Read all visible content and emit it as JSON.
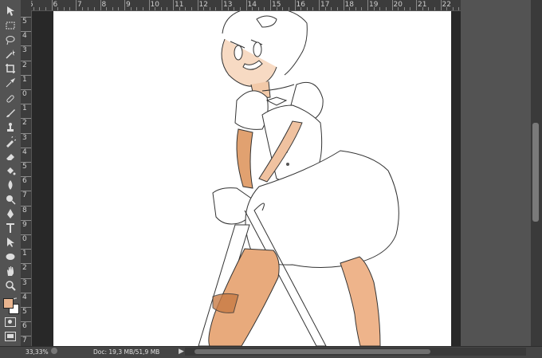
{
  "ruler": {
    "top_ticks": [
      "5",
      "6",
      "7",
      "8",
      "9",
      "10",
      "11",
      "12",
      "13",
      "14",
      "15",
      "16",
      "17",
      "18",
      "19",
      "20",
      "21",
      "22"
    ],
    "left_ticks": [
      "5",
      "4",
      "3",
      "2",
      "1",
      "0",
      "1",
      "2",
      "3",
      "4",
      "5",
      "6",
      "7",
      "8",
      "9",
      "0",
      "1",
      "2",
      "3",
      "4",
      "5",
      "6",
      "7"
    ]
  },
  "tools": [
    {
      "name": "move-tool-icon"
    },
    {
      "name": "marquee-tool-icon"
    },
    {
      "name": "lasso-tool-icon"
    },
    {
      "name": "magic-wand-tool-icon"
    },
    {
      "name": "crop-tool-icon"
    },
    {
      "name": "eyedropper-tool-icon"
    },
    {
      "name": "healing-brush-tool-icon"
    },
    {
      "name": "brush-tool-icon"
    },
    {
      "name": "clone-stamp-tool-icon"
    },
    {
      "name": "history-brush-tool-icon"
    },
    {
      "name": "eraser-tool-icon"
    },
    {
      "name": "paint-bucket-tool-icon"
    },
    {
      "name": "blur-tool-icon"
    },
    {
      "name": "dodge-tool-icon"
    },
    {
      "name": "pen-tool-icon"
    },
    {
      "name": "type-tool-icon"
    },
    {
      "name": "path-selection-tool-icon"
    },
    {
      "name": "ellipse-tool-icon"
    },
    {
      "name": "hand-tool-icon"
    },
    {
      "name": "zoom-tool-icon"
    }
  ],
  "colors": {
    "foreground": "#e8b48f",
    "background": "#ffffff",
    "skin_shadow": "#d9925e"
  },
  "status": {
    "zoom": "33,33%",
    "doc": "Doc: 19,3 MB/51,9 MB"
  }
}
